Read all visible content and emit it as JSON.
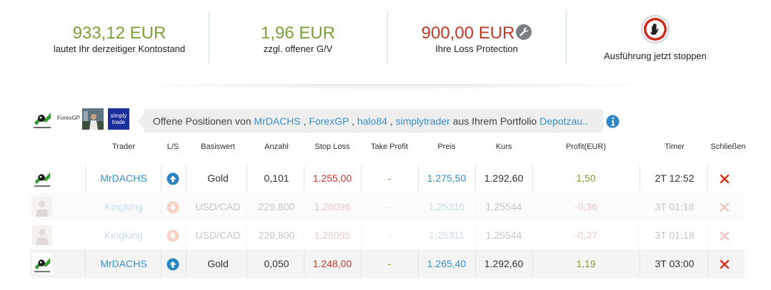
{
  "stats": {
    "balance_value": "933,12 EUR",
    "balance_label": "lautet Ihr derzeitiger Kontostand",
    "pl_value": "1,96 EUR",
    "pl_label": "zzgl. offener G/V",
    "loss_value": "900,00 EUR",
    "loss_label": "Ihre Loss Protection",
    "stop_label": "Ausführung jetzt stoppen"
  },
  "header": {
    "thumb_forex": "ForexGP",
    "thumb_simply_1": "simply",
    "thumb_simply_2": "trade",
    "intro": "Offene Positionen von ",
    "trader1": "MrDACHS",
    "sep1": " , ",
    "trader2": "ForexGP",
    "sep2": " , ",
    "trader3": "halo84",
    "sep3": " , ",
    "trader4": "simplytrader",
    "mid": " aus Ihrem Portfolio ",
    "portfolio": "Depotzau.."
  },
  "table": {
    "columns": [
      "Trader",
      "L/S",
      "Basiswert",
      "Anzahl",
      "Stop Loss",
      "Take Profit",
      "Preis",
      "Kurs",
      "Profit(EUR)",
      "Timer",
      "Schließen"
    ],
    "rows": [
      {
        "trader": "MrDACHS",
        "direction": "up",
        "asset": "Gold",
        "amount": "0,101",
        "stop_loss": "1.255,00",
        "take_profit": "-",
        "price": "1.275,50",
        "rate": "1.292,60",
        "profit": "1,50",
        "timer": "2T 12:52",
        "faded": false
      },
      {
        "trader": "Kingking",
        "direction": "down",
        "asset": "USD/CAD",
        "amount": "229,800",
        "stop_loss": "1,26096",
        "take_profit": "-",
        "price": "1,25316",
        "rate": "1,25544",
        "profit": "-0,36",
        "timer": "3T 01:18",
        "faded": true
      },
      {
        "trader": "Kingking",
        "direction": "down",
        "asset": "USD/CAD",
        "amount": "229,800",
        "stop_loss": "1,26095",
        "take_profit": "-",
        "price": "1,25311",
        "rate": "1,25544",
        "profit": "-0,37",
        "timer": "3T 01:18",
        "faded": true
      },
      {
        "trader": "MrDACHS",
        "direction": "up",
        "asset": "Gold",
        "amount": "0,050",
        "stop_loss": "1.248,00",
        "take_profit": "-",
        "price": "1.265,40",
        "rate": "1.292,60",
        "profit": "1,19",
        "timer": "3T 03:00",
        "faded": false
      }
    ]
  },
  "colors": {
    "green": "#7aa03a",
    "red": "#c0392b",
    "link_blue": "#3a8fc6",
    "up_icon": "#2a84c4",
    "down_icon": "#e0603a",
    "close_icon": "#d9311e"
  },
  "icons": {
    "wrench": "wrench-icon",
    "stop": "stop-hand-icon",
    "info": "info-icon",
    "up": "arrow-up-circle-icon",
    "down": "arrow-down-circle-icon",
    "close": "close-x-icon"
  }
}
